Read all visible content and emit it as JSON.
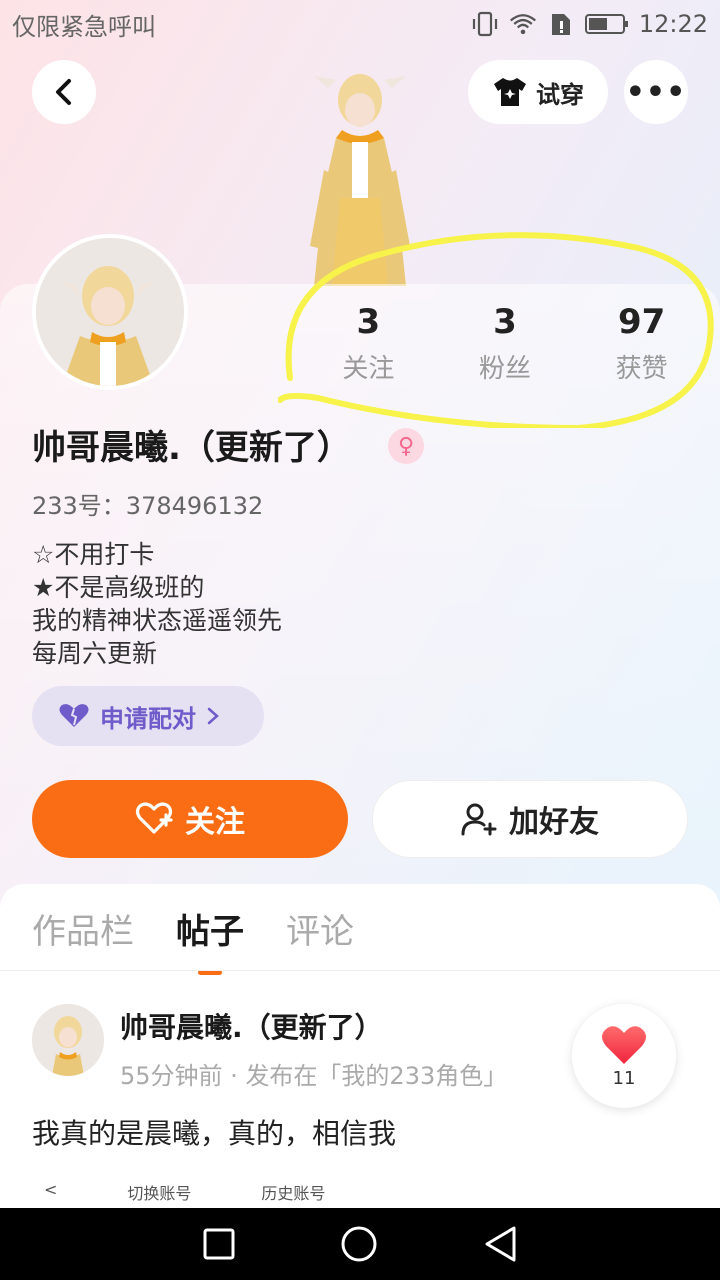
{
  "status_bar": {
    "carrier": "仅限紧急呼叫",
    "time": "12:22",
    "icons": [
      "vibrate-icon",
      "wifi-icon",
      "sim-icon",
      "battery-icon"
    ]
  },
  "header": {
    "try_on_label": "试穿",
    "more_label": "•••"
  },
  "stats": [
    {
      "value": "3",
      "label": "关注"
    },
    {
      "value": "3",
      "label": "粉丝"
    },
    {
      "value": "97",
      "label": "获赞"
    }
  ],
  "profile": {
    "name": "帅哥晨曦.（更新了）",
    "gender_symbol": "♀",
    "uid": "233号：378496132",
    "bio": [
      "☆不用打卡",
      "★不是高级班的",
      "我的精神状态遥遥领先",
      "每周六更新"
    ],
    "pair_label": "申请配对"
  },
  "actions": {
    "follow_label": "关注",
    "add_friend_label": "加好友"
  },
  "tabs": [
    {
      "label": "作品栏",
      "active": false
    },
    {
      "label": "帖子",
      "active": true
    },
    {
      "label": "评论",
      "active": false
    }
  ],
  "post": {
    "author": "帅哥晨曦.（更新了）",
    "meta": "55分钟前 · 发布在「我的233角色」",
    "text": "我真的是晨曦，真的，相信我",
    "likes": "11",
    "handwritten": [
      "<",
      "切换账号",
      "历史账号"
    ]
  },
  "colors": {
    "accent": "#fa6d14",
    "pair": "#6f5bc9",
    "highlight": "#f7f34a"
  }
}
